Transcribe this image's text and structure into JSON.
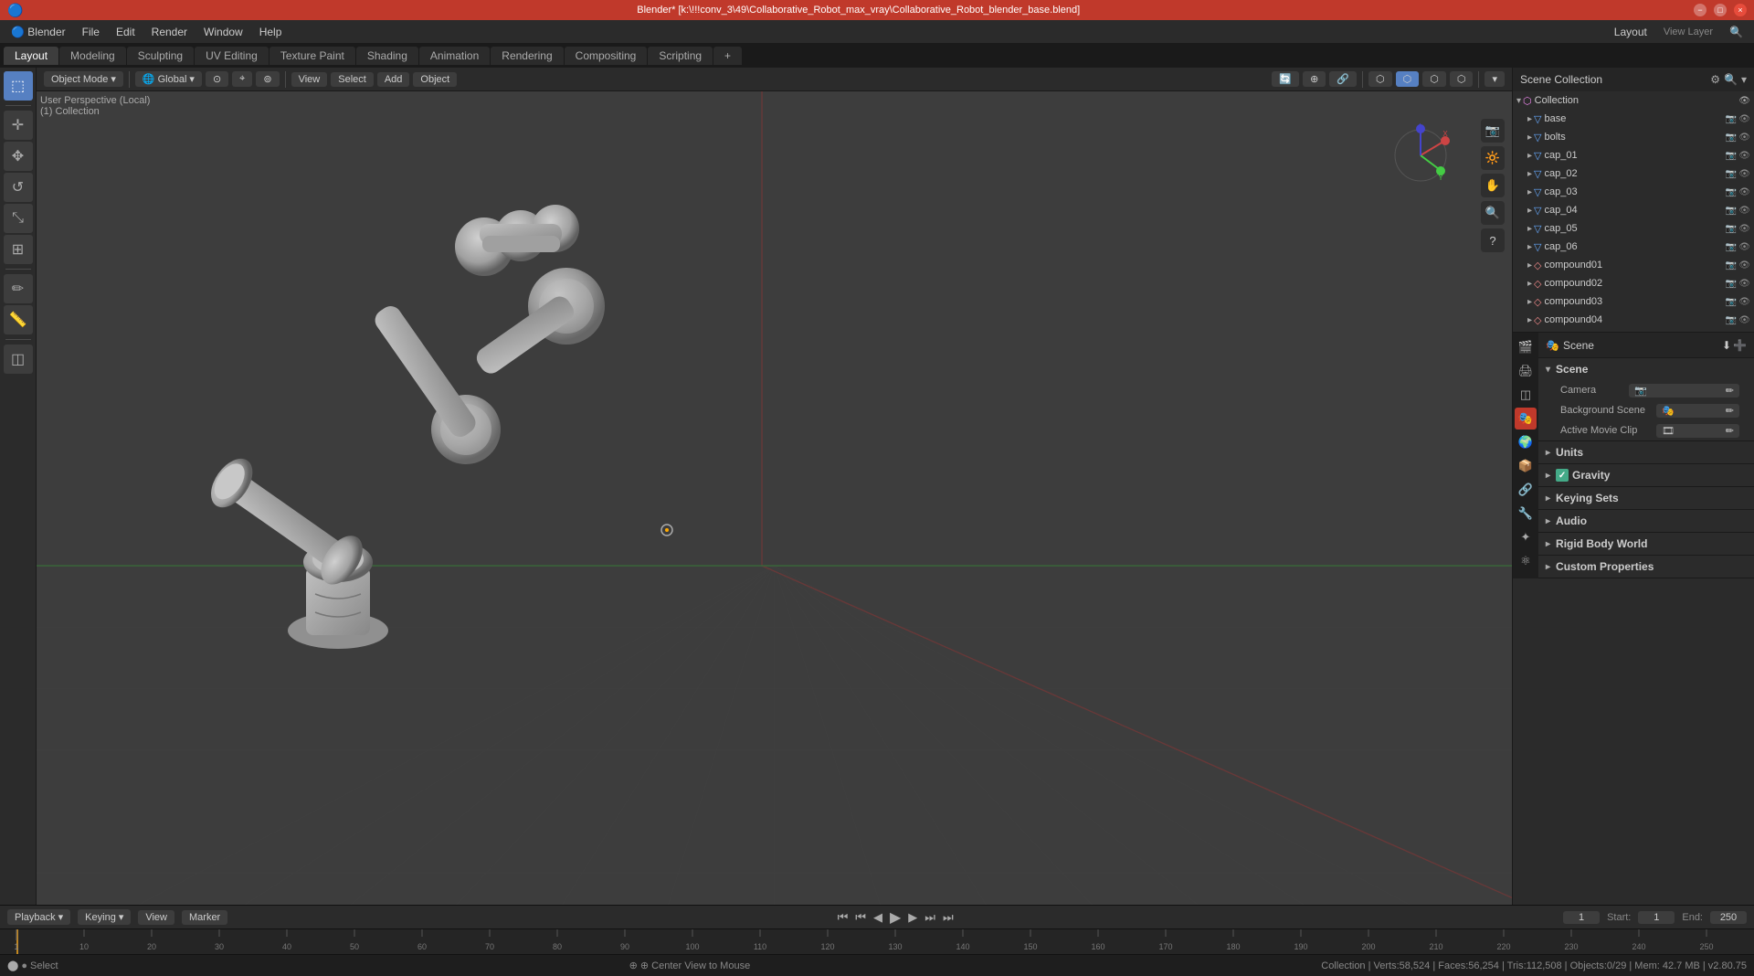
{
  "window": {
    "title": "Blender* [k:\\!!!conv_3\\49\\Collaborative_Robot_max_vray\\Collaborative_Robot_blender_base.blend]",
    "controls": [
      "−",
      "□",
      "×"
    ]
  },
  "menu": {
    "items": [
      "Blender",
      "File",
      "Edit",
      "Render",
      "Window",
      "Help"
    ]
  },
  "workspace_tabs": {
    "tabs": [
      "Layout",
      "Modeling",
      "Sculpting",
      "UV Editing",
      "Texture Paint",
      "Shading",
      "Animation",
      "Rendering",
      "Compositing",
      "Scripting",
      "+"
    ],
    "active": "Layout"
  },
  "viewport": {
    "mode_label": "Object Mode",
    "mode_arrow": "▾",
    "global_label": "Global",
    "view_label": "View",
    "select_label": "Select",
    "add_label": "Add",
    "object_label": "Object",
    "info_line1": "User Perspective (Local)",
    "info_line2": "(1) Collection",
    "center_label": "1",
    "start_label": "Start:",
    "start_val": "1",
    "end_label": "End:",
    "end_val": "250"
  },
  "outliner": {
    "title": "Scene Collection",
    "items": [
      {
        "name": "Collection",
        "indent": 0,
        "type": "collection",
        "expanded": true
      },
      {
        "name": "base",
        "indent": 1,
        "type": "mesh",
        "icons": [
          "camera",
          "eye"
        ]
      },
      {
        "name": "bolts",
        "indent": 1,
        "type": "mesh",
        "icons": [
          "camera",
          "eye"
        ]
      },
      {
        "name": "cap_01",
        "indent": 1,
        "type": "mesh",
        "icons": [
          "camera",
          "eye"
        ]
      },
      {
        "name": "cap_02",
        "indent": 1,
        "type": "mesh",
        "icons": [
          "camera",
          "eye"
        ]
      },
      {
        "name": "cap_03",
        "indent": 1,
        "type": "mesh",
        "icons": [
          "camera",
          "eye"
        ]
      },
      {
        "name": "cap_04",
        "indent": 1,
        "type": "mesh",
        "icons": [
          "camera",
          "eye"
        ]
      },
      {
        "name": "cap_05",
        "indent": 1,
        "type": "mesh",
        "icons": [
          "camera",
          "eye"
        ]
      },
      {
        "name": "cap_06",
        "indent": 1,
        "type": "mesh",
        "icons": [
          "camera",
          "eye"
        ]
      },
      {
        "name": "compound01",
        "indent": 1,
        "type": "compound",
        "icons": [
          "camera",
          "eye"
        ]
      },
      {
        "name": "compound02",
        "indent": 1,
        "type": "compound",
        "icons": [
          "camera",
          "eye"
        ]
      },
      {
        "name": "compound03",
        "indent": 1,
        "type": "compound",
        "icons": [
          "camera",
          "eye"
        ]
      },
      {
        "name": "compound04",
        "indent": 1,
        "type": "compound",
        "icons": [
          "camera",
          "eye"
        ]
      }
    ]
  },
  "properties": {
    "current_tab": "scene",
    "title": "Scene",
    "subtitle": "Scene",
    "sections": [
      {
        "name": "Scene",
        "expanded": true,
        "rows": [
          {
            "label": "Camera",
            "type": "select",
            "value": ""
          },
          {
            "label": "Background Scene",
            "type": "select",
            "value": ""
          },
          {
            "label": "Active Movie Clip",
            "type": "select",
            "value": ""
          }
        ]
      },
      {
        "name": "Units",
        "expanded": false,
        "rows": []
      },
      {
        "name": "Gravity",
        "expanded": false,
        "rows": [],
        "checkbox": true,
        "checked": true
      },
      {
        "name": "Keying Sets",
        "expanded": false,
        "rows": []
      },
      {
        "name": "Audio",
        "expanded": false,
        "rows": []
      },
      {
        "name": "Rigid Body World",
        "expanded": false,
        "rows": []
      },
      {
        "name": "Custom Properties",
        "expanded": false,
        "rows": []
      }
    ],
    "side_icons": [
      "render",
      "output",
      "view_layer",
      "scene",
      "world",
      "object",
      "constraints",
      "modifiers",
      "particles",
      "physics"
    ]
  },
  "timeline": {
    "playback_label": "Playback",
    "keying_label": "Keying",
    "view_label": "View",
    "marker_label": "Marker",
    "current_frame": "1",
    "start_label": "Start:",
    "start_val": "1",
    "end_label": "End:",
    "end_val": "250",
    "ruler_marks": [
      "1",
      "10",
      "20",
      "30",
      "40",
      "50",
      "60",
      "70",
      "80",
      "90",
      "100",
      "110",
      "120",
      "130",
      "140",
      "150",
      "160",
      "170",
      "180",
      "190",
      "200",
      "210",
      "220",
      "230",
      "240",
      "250"
    ],
    "transport_buttons": [
      "⏮",
      "⏮",
      "◀",
      "⏹",
      "▶",
      "⏭",
      "⏭"
    ]
  },
  "status_bar": {
    "left_label": "● Select",
    "center_label": "⊕ Center View to Mouse",
    "right_label": "Collection | Verts:58,524 | Faces:56,254 | Tris:112,508 | Objects:0/29 | Mem: 42.7 MB | v2.80.75"
  },
  "colors": {
    "accent_red": "#c0392b",
    "bg_dark": "#1a1a1a",
    "bg_mid": "#2b2b2b",
    "bg_light": "#3d3d3d",
    "text_main": "#cccccc",
    "text_dim": "#888888",
    "blue_accent": "#5680c2",
    "grid_color": "#555555"
  }
}
